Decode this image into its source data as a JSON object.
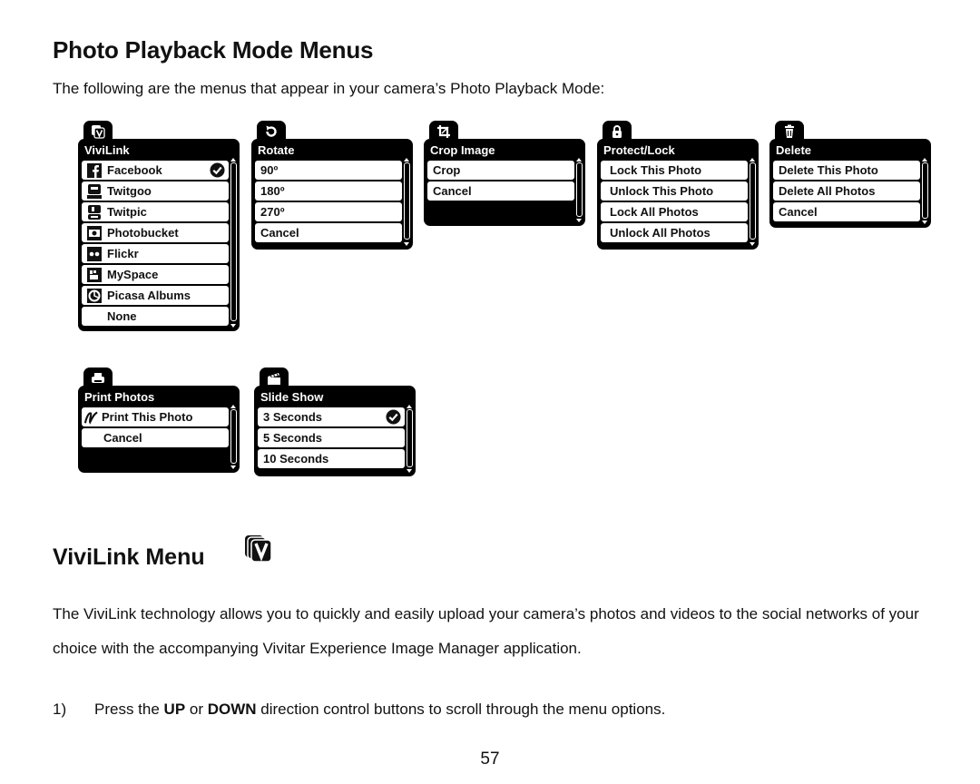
{
  "heading": "Photo Playback Mode Menus",
  "intro": "The following are the menus that appear in your camera’s Photo Playback Mode:",
  "menus": [
    {
      "id": "vivilink",
      "icon": "vivilink-icon",
      "title": "ViviLink",
      "items": [
        {
          "label": "Facebook",
          "icon": "facebook-icon",
          "selected": true
        },
        {
          "label": "Twitgoo",
          "icon": "twitgoo-icon",
          "selected": false
        },
        {
          "label": "Twitpic",
          "icon": "twitpic-icon",
          "selected": false
        },
        {
          "label": "Photobucket",
          "icon": "photobucket-icon",
          "selected": false
        },
        {
          "label": "Flickr",
          "icon": "flickr-icon",
          "selected": false
        },
        {
          "label": "MySpace",
          "icon": "myspace-icon",
          "selected": false
        },
        {
          "label": "Picasa Albums",
          "icon": "picasa-icon",
          "selected": false
        },
        {
          "label": "None",
          "icon": "",
          "selected": false
        }
      ]
    },
    {
      "id": "rotate",
      "icon": "rotate-icon",
      "title": "Rotate",
      "items": [
        {
          "label": "90º"
        },
        {
          "label": "180º"
        },
        {
          "label": "270º"
        },
        {
          "label": "Cancel"
        }
      ]
    },
    {
      "id": "crop",
      "icon": "crop-icon",
      "title": "Crop Image",
      "items": [
        {
          "label": "Crop"
        },
        {
          "label": "Cancel"
        }
      ]
    },
    {
      "id": "protect",
      "icon": "lock-icon",
      "title": "Protect/Lock",
      "items": [
        {
          "label": "Lock This Photo"
        },
        {
          "label": "Unlock This Photo"
        },
        {
          "label": "Lock All Photos"
        },
        {
          "label": "Unlock All Photos"
        }
      ]
    },
    {
      "id": "delete",
      "icon": "trash-icon",
      "title": "Delete",
      "items": [
        {
          "label": "Delete This Photo"
        },
        {
          "label": "Delete All Photos"
        },
        {
          "label": "Cancel"
        }
      ]
    },
    {
      "id": "print",
      "icon": "printer-icon",
      "title": "Print Photos",
      "items": [
        {
          "label": "Print This Photo",
          "icon": "pictbridge-icon"
        },
        {
          "label": "Cancel",
          "icon": ""
        }
      ]
    },
    {
      "id": "slideshow",
      "icon": "clapperboard-icon",
      "title": "Slide Show",
      "items": [
        {
          "label": "3 Seconds",
          "selected": true
        },
        {
          "label": "5 Seconds"
        },
        {
          "label": "10 Seconds"
        }
      ]
    }
  ],
  "section": {
    "heading": "ViviLink Menu",
    "icon": "vivilink-icon",
    "paragraph": "The ViviLink technology allows you to quickly and easily upload your camera’s photos and videos to the social networks of your choice with the accompanying Vivitar Experience Image Manager application.",
    "step": {
      "number": "1)",
      "text_before": "Press the ",
      "bold1": "UP",
      "text_mid": " or ",
      "bold2": "DOWN",
      "text_after": " direction control buttons to scroll through the menu options."
    }
  },
  "page_number": "57"
}
